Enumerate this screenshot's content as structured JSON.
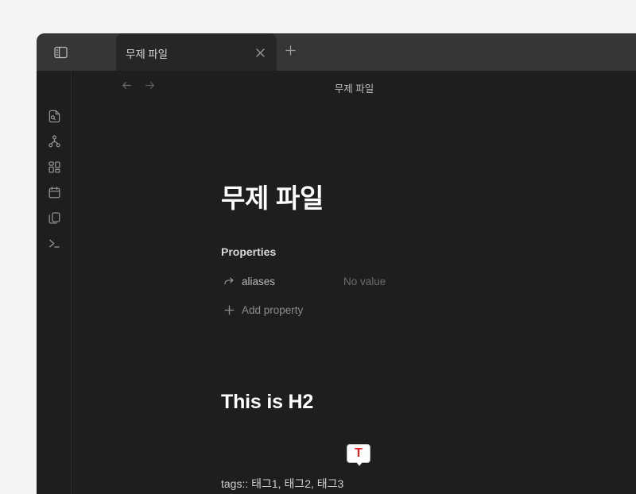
{
  "window": {
    "background_color": "#1e1e1e",
    "tabbar_color": "#363636",
    "page_color": "#f4f4f4"
  },
  "tabbar": {
    "sidebar_toggle_name": "sidebar-toggle-icon",
    "tabs": [
      {
        "label": "무제 파일",
        "active": true,
        "close_label": "×"
      }
    ],
    "new_tab_label": "+"
  },
  "ribbon": {
    "items": [
      {
        "name": "file-search-icon",
        "tooltip": "Quick switcher"
      },
      {
        "name": "graph-icon",
        "tooltip": "Graph view"
      },
      {
        "name": "canvas-grid-icon",
        "tooltip": "Canvas"
      },
      {
        "name": "calendar-icon",
        "tooltip": "Daily note"
      },
      {
        "name": "copy-files-icon",
        "tooltip": "Templates"
      },
      {
        "name": "terminal-icon",
        "tooltip": "Terminal"
      }
    ]
  },
  "view_header": {
    "back_icon": "arrow-left-icon",
    "forward_icon": "arrow-right-icon",
    "inline_title": "무제 파일"
  },
  "note": {
    "title": "무제 파일",
    "properties_heading": "Properties",
    "properties": [
      {
        "icon": "forward-arrow-icon",
        "key": "aliases",
        "value": "No value"
      }
    ],
    "add_property_label": "Add property",
    "add_property_icon": "plus-icon",
    "headings": [
      {
        "level": 2,
        "text": "This is H2"
      }
    ],
    "body_text": "tags:: 태그1, 태그2, 태그3"
  },
  "cursor_badge": {
    "letter": "T",
    "letter_color": "#e02020",
    "background_color": "#ffffff",
    "name": "text-tool-cursor-badge"
  }
}
